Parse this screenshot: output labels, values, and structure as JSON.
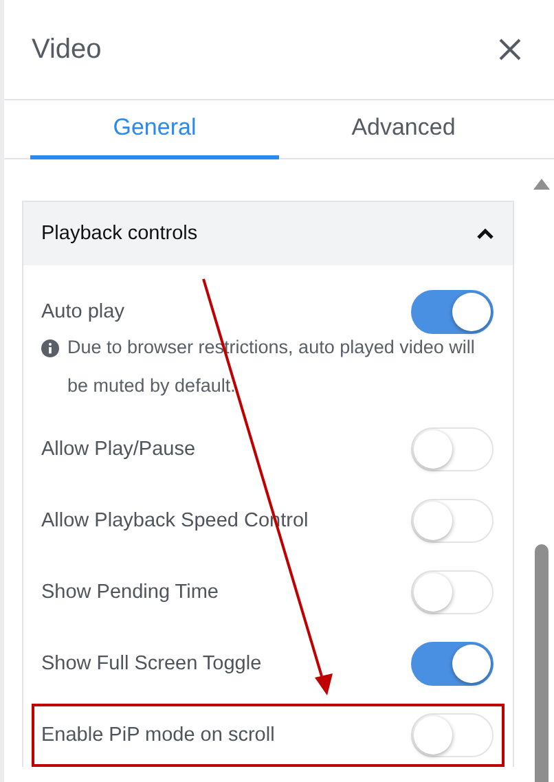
{
  "panel": {
    "title": "Video"
  },
  "tabs": [
    {
      "label": "General",
      "selected": true
    },
    {
      "label": "Advanced",
      "selected": false
    }
  ],
  "section": {
    "title": "Playback controls",
    "expanded": true,
    "settings": [
      {
        "label": "Auto play",
        "on": true,
        "note": "Due to browser restrictions, auto played video will be muted by default.",
        "highlighted": false
      },
      {
        "label": "Allow Play/Pause",
        "on": false,
        "highlighted": false
      },
      {
        "label": "Allow Playback Speed Control",
        "on": false,
        "highlighted": false
      },
      {
        "label": "Show Pending Time",
        "on": false,
        "highlighted": false
      },
      {
        "label": "Show Full Screen Toggle",
        "on": true,
        "highlighted": false
      },
      {
        "label": "Enable PiP mode on scroll",
        "on": false,
        "highlighted": true
      }
    ]
  }
}
